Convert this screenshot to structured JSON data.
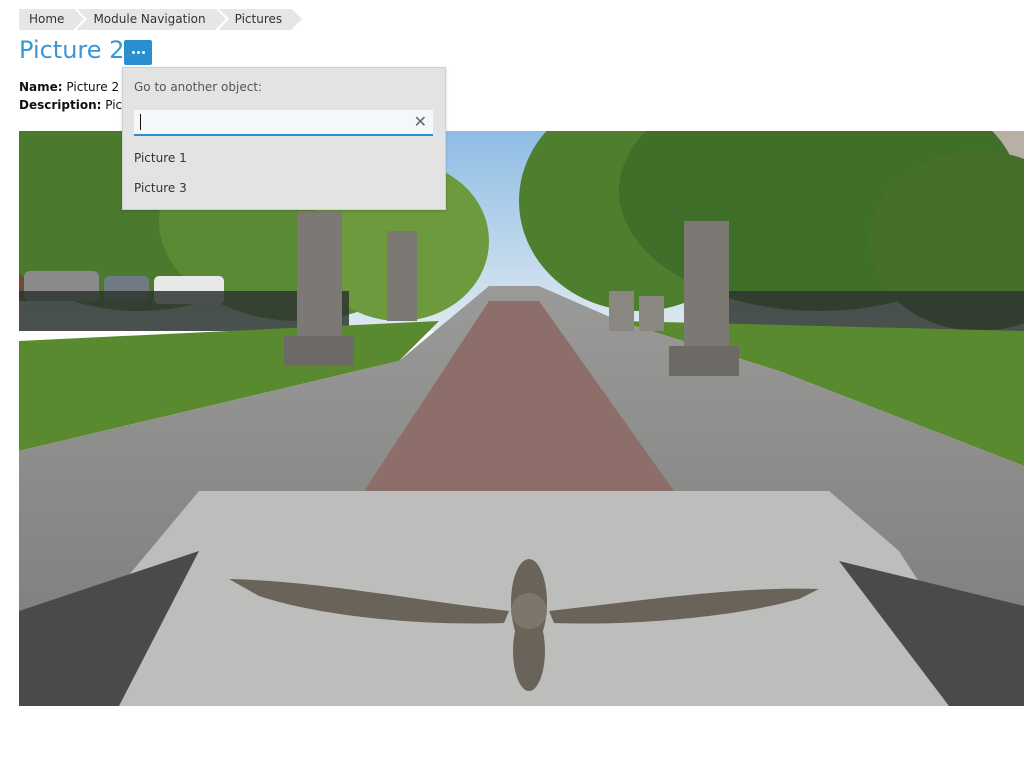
{
  "breadcrumb": [
    "Home",
    "Module Navigation",
    "Pictures"
  ],
  "page": {
    "title": "Picture 2",
    "name_label": "Name:",
    "name_value": "Picture 2",
    "description_label": "Description:",
    "description_value": "Pictu"
  },
  "dropdown": {
    "label": "Go to another object:",
    "search_value": "",
    "options": [
      "Picture 1",
      "Picture 3"
    ]
  },
  "colors": {
    "accent": "#2a8fd0",
    "title": "#3a96d4",
    "breadcrumb_bg": "#e6e6e6"
  },
  "icons": {
    "more": "more-horizontal-icon",
    "clear": "clear-x-icon"
  }
}
